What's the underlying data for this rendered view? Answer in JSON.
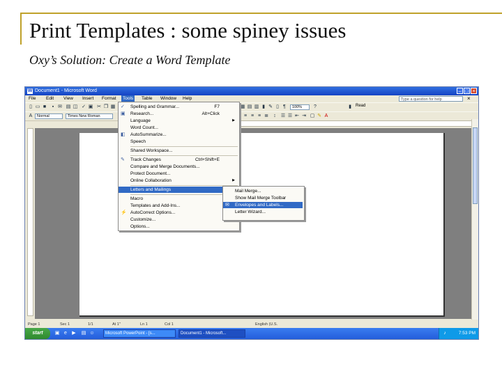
{
  "slide": {
    "title": "Print Templates : some spiney issues",
    "subtitle": "Oxy’s Solution: Create a Word Template"
  },
  "window": {
    "title": "Document1 - Microsoft Word",
    "controls": [
      "minimize",
      "maximize",
      "close"
    ]
  },
  "menubar": {
    "items": [
      "File",
      "Edit",
      "View",
      "Insert",
      "Format",
      "Tools",
      "Table",
      "Window",
      "Help"
    ],
    "active": "Tools",
    "ask_placeholder": "Type a question for help"
  },
  "toolbar": {
    "style_value": "Normal",
    "font_value": "Times New Roman",
    "zoom_value": "100%",
    "read_label": "Read"
  },
  "tools_menu": {
    "items": [
      {
        "label": "Spelling and Grammar...",
        "shortcut": "F7",
        "icon": "spelling-icon"
      },
      {
        "label": "Research...",
        "shortcut": "Alt+Click",
        "icon": "research-icon"
      },
      {
        "label": "Language",
        "submenu": true
      },
      {
        "label": "Word Count..."
      },
      {
        "label": "AutoSummarize...",
        "icon": "autosummarize-icon"
      },
      {
        "label": "Speech"
      },
      {
        "label": "Shared Workspace..."
      },
      {
        "label": "Track Changes",
        "shortcut": "Ctrl+Shift+E",
        "icon": "track-changes-icon"
      },
      {
        "label": "Compare and Merge Documents..."
      },
      {
        "label": "Protect Document..."
      },
      {
        "label": "Online Collaboration",
        "submenu": true
      },
      {
        "label": "Letters and Mailings",
        "submenu": true,
        "highlighted": true
      },
      {
        "label": "Macro",
        "submenu": true
      },
      {
        "label": "Templates and Add-Ins..."
      },
      {
        "label": "AutoCorrect Options...",
        "icon": "autocorrect-icon"
      },
      {
        "label": "Customize..."
      },
      {
        "label": "Options..."
      }
    ]
  },
  "letters_submenu": {
    "items": [
      {
        "label": "Mail Merge..."
      },
      {
        "label": "Show Mail Merge Toolbar"
      },
      {
        "label": "Envelopes and Labels...",
        "highlighted": true,
        "icon": "envelope-icon"
      },
      {
        "label": "Letter Wizard..."
      }
    ]
  },
  "statusbar": {
    "page": "Page 1",
    "section": "Sec 1",
    "page_of": "1/1",
    "position": "At 1\"",
    "line": "Ln 1",
    "col": "Col 1",
    "language": "English (U.S."
  },
  "taskbar": {
    "start_label": "start",
    "tasks": [
      {
        "label": "Microsoft PowerPoint - [s...",
        "active": false
      },
      {
        "label": "Document1 - Microsoft...",
        "active": true
      }
    ],
    "clock": "7:53 PM"
  }
}
